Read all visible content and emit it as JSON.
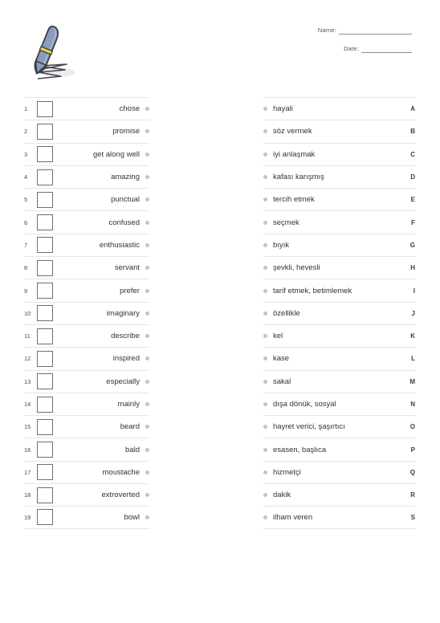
{
  "header": {
    "art_icon": "fountain-pen-writing-icon",
    "pen_body_color": "#8296b8",
    "pen_band_color": "#e8d84a",
    "pen_outline_color": "#3c3c46",
    "name_label": "Name:",
    "name_value": "",
    "name_placeholder": "",
    "date_label": "Date:",
    "date_value": "",
    "date_placeholder": ""
  },
  "style": {
    "divider_color": "#e6e6e6",
    "dot_color": "#c4c4c4",
    "box_border_color": "#6f6f6f",
    "text_color": "#333333"
  },
  "left_column": {
    "bullet_icon": "bullet-dot-icon",
    "items": [
      {
        "number": "1",
        "term": "chose",
        "answer": ""
      },
      {
        "number": "2",
        "term": "promise",
        "answer": ""
      },
      {
        "number": "3",
        "term": "get along well",
        "answer": ""
      },
      {
        "number": "4",
        "term": "amazing",
        "answer": ""
      },
      {
        "number": "5",
        "term": "punctual",
        "answer": ""
      },
      {
        "number": "6",
        "term": "confused",
        "answer": ""
      },
      {
        "number": "7",
        "term": "enthusiastic",
        "answer": ""
      },
      {
        "number": "8",
        "term": "servant",
        "answer": ""
      },
      {
        "number": "9",
        "term": "prefer",
        "answer": ""
      },
      {
        "number": "10",
        "term": "imaginary",
        "answer": ""
      },
      {
        "number": "11",
        "term": "describe",
        "answer": ""
      },
      {
        "number": "12",
        "term": "inspired",
        "answer": ""
      },
      {
        "number": "13",
        "term": "especially",
        "answer": ""
      },
      {
        "number": "14",
        "term": "mainly",
        "answer": ""
      },
      {
        "number": "15",
        "term": "beard",
        "answer": ""
      },
      {
        "number": "16",
        "term": "bald",
        "answer": ""
      },
      {
        "number": "17",
        "term": "moustache",
        "answer": ""
      },
      {
        "number": "18",
        "term": "extroverted",
        "answer": ""
      },
      {
        "number": "19",
        "term": "bowl",
        "answer": ""
      }
    ]
  },
  "right_column": {
    "bullet_icon": "bullet-dot-icon",
    "items": [
      {
        "letter": "A",
        "term": "hayali"
      },
      {
        "letter": "B",
        "term": "söz vermek"
      },
      {
        "letter": "C",
        "term": "iyi anlaşmak"
      },
      {
        "letter": "D",
        "term": "kafası karışmış"
      },
      {
        "letter": "E",
        "term": "tercih etmek"
      },
      {
        "letter": "F",
        "term": "seçmek"
      },
      {
        "letter": "G",
        "term": "bıyık"
      },
      {
        "letter": "H",
        "term": "şevkli, hevesli"
      },
      {
        "letter": "I",
        "term": "tarif etmek, betimlemek"
      },
      {
        "letter": "J",
        "term": "özellikle"
      },
      {
        "letter": "K",
        "term": "kel"
      },
      {
        "letter": "L",
        "term": "kase"
      },
      {
        "letter": "M",
        "term": "sakal"
      },
      {
        "letter": "N",
        "term": "dışa dönük, sosyal"
      },
      {
        "letter": "O",
        "term": "hayret verici, şaşırtıcı"
      },
      {
        "letter": "P",
        "term": "esasen, başlıca"
      },
      {
        "letter": "Q",
        "term": "hizmetçi"
      },
      {
        "letter": "R",
        "term": "dakik"
      },
      {
        "letter": "S",
        "term": "ilham veren"
      }
    ]
  }
}
